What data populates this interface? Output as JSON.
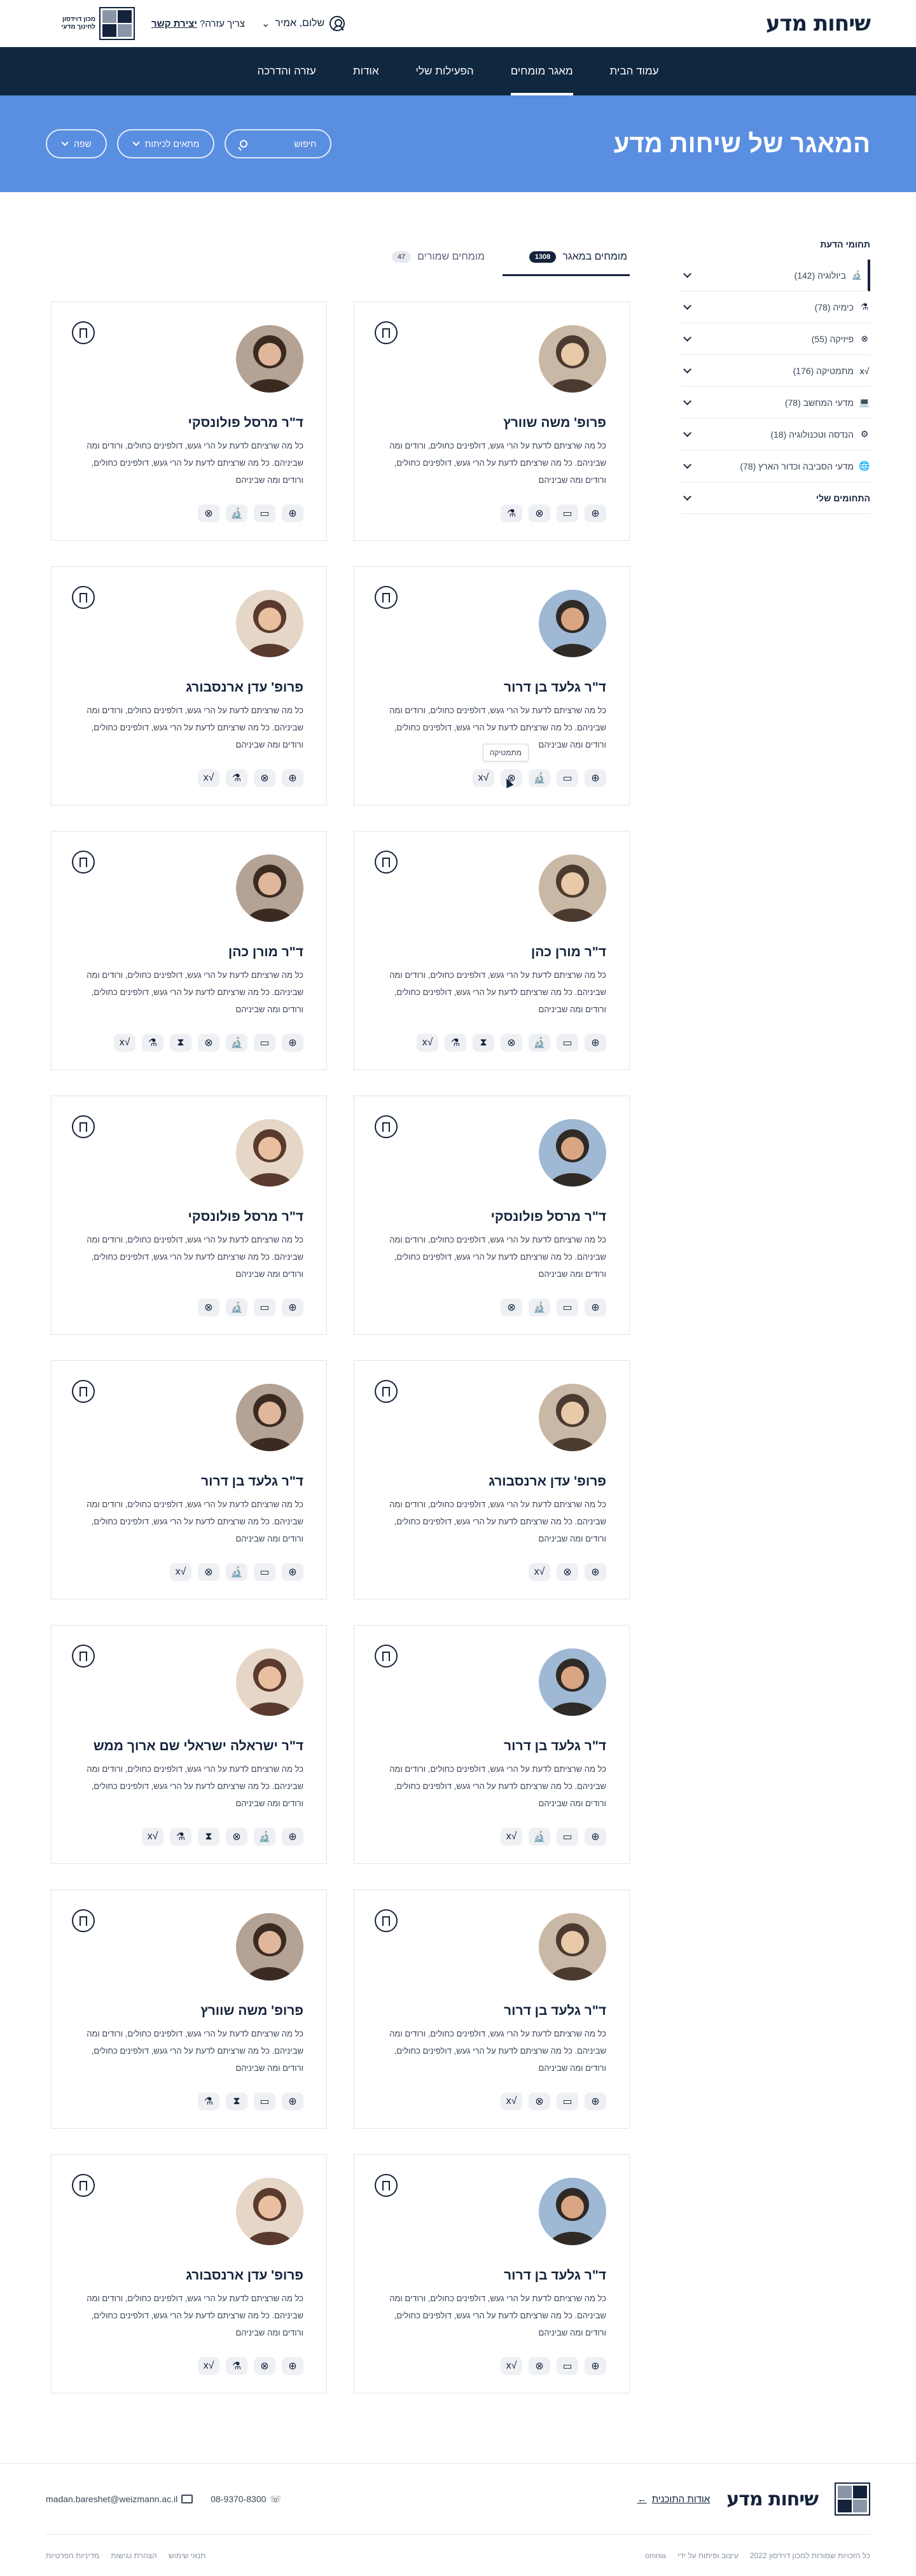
{
  "header": {
    "brand": "שיחות מדע",
    "user_greeting": "שלום, אמיר",
    "help_text": "צריך עזרה?",
    "help_link": "יצירת קשר",
    "logo_text": "מכון דוידסון לחינוך מדעי"
  },
  "nav": {
    "items": [
      {
        "label": "עמוד הבית"
      },
      {
        "label": "מאגר מומחים"
      },
      {
        "label": "הפעילות שלי"
      },
      {
        "label": "אודות"
      },
      {
        "label": "עזרה והדרכה"
      }
    ]
  },
  "hero": {
    "title": "המאגר של שיחות מדע",
    "search_placeholder": "חיפוש",
    "filter_topics": "מתאים לכיתות",
    "filter_year": "שפה"
  },
  "sidebar": {
    "title": "תחומי הדעת",
    "items": [
      {
        "label": "ביולוגיה (142)",
        "icon": "microscope-icon"
      },
      {
        "label": "כימיה (78)",
        "icon": "flask-icon"
      },
      {
        "label": "פיזיקה (55)",
        "icon": "atom-icon"
      },
      {
        "label": "מתמטיקה (176)",
        "icon": "sqrt-icon"
      },
      {
        "label": "מדעי המחשב (78)",
        "icon": "laptop-icon"
      },
      {
        "label": "הנדסה וטכנולוגיה (18)",
        "icon": "gear-icon"
      },
      {
        "label": "מדעי הסביבה וכדור הארץ (78)",
        "icon": "globe-icon"
      }
    ],
    "my_topics": "התחומים שלי"
  },
  "tabs": {
    "experts_label": "מומחים במאגר",
    "experts_count": "1308",
    "saved_label": "מומחים שמורים",
    "saved_count": "47"
  },
  "cards": [
    {
      "name": "פרופ' משה שוורץ",
      "desc": "כל מה שרציתם לדעת על הרי געש, דולפינים כחולים, ורודים ומה שביניהם. כל מה שרציתם לדעת על הרי געש, דולפינים כחולים, ורודים ומה שביניהם"
    },
    {
      "name": "ד\"ר מרסל פולונסקי",
      "desc": "כל מה שרציתם לדעת על הרי געש, דולפינים כחולים, ורודים ומה שביניהם. כל מה שרציתם לדעת על הרי געש, דולפינים כחולים, ורודים ומה שביניהם"
    },
    {
      "name": "ד\"ר גלעד בן דרור",
      "desc": "כל מה שרציתם לדעת על הרי געש, דולפינים כחולים, ורודים ומה שביניהם. כל מה שרציתם לדעת על הרי געש, דולפינים כחולים, ורודים ומה שביניהם",
      "tooltip": "מתמטיקה"
    },
    {
      "name": "פרופ' עדן ארנסבורג",
      "desc": "כל מה שרציתם לדעת על הרי געש, דולפינים כחולים, ורודים ומה שביניהם. כל מה שרציתם לדעת על הרי געש, דולפינים כחולים, ורודים ומה שביניהם"
    },
    {
      "name": "ד\"ר מורן כהן",
      "desc": "כל מה שרציתם לדעת על הרי געש, דולפינים כחולים, ורודים ומה שביניהם. כל מה שרציתם לדעת על הרי געש, דולפינים כחולים, ורודים ומה שביניהם"
    },
    {
      "name": "ד\"ר מורן כהן",
      "desc": "כל מה שרציתם לדעת על הרי געש, דולפינים כחולים, ורודים ומה שביניהם. כל מה שרציתם לדעת על הרי געש, דולפינים כחולים, ורודים ומה שביניהם"
    },
    {
      "name": "ד\"ר מרסל פולונסקי",
      "desc": "כל מה שרציתם לדעת על הרי געש, דולפינים כחולים, ורודים ומה שביניהם. כל מה שרציתם לדעת על הרי געש, דולפינים כחולים, ורודים ומה שביניהם"
    },
    {
      "name": "ד\"ר מרסל פולונסקי",
      "desc": "כל מה שרציתם לדעת על הרי געש, דולפינים כחולים, ורודים ומה שביניהם. כל מה שרציתם לדעת על הרי געש, דולפינים כחולים, ורודים ומה שביניהם"
    },
    {
      "name": "פרופ' עדן ארנסבורג",
      "desc": "כל מה שרציתם לדעת על הרי געש, דולפינים כחולים, ורודים ומה שביניהם. כל מה שרציתם לדעת על הרי געש, דולפינים כחולים, ורודים ומה שביניהם"
    },
    {
      "name": "ד\"ר גלעד בן דרור",
      "desc": "כל מה שרציתם לדעת על הרי געש, דולפינים כחולים, ורודים ומה שביניהם. כל מה שרציתם לדעת על הרי געש, דולפינים כחולים, ורודים ומה שביניהם"
    },
    {
      "name": "ד\"ר גלעד בן דרור",
      "desc": "כל מה שרציתם לדעת על הרי געש, דולפינים כחולים, ורודים ומה שביניהם. כל מה שרציתם לדעת על הרי געש, דולפינים כחולים, ורודים ומה שביניהם"
    },
    {
      "name": "ד\"ר ישראלה ישראלי שם ארוך ממש",
      "desc": "כל מה שרציתם לדעת על הרי געש, דולפינים כחולים, ורודים ומה שביניהם. כל מה שרציתם לדעת על הרי געש, דולפינים כחולים, ורודים ומה שביניהם"
    },
    {
      "name": "ד\"ר גלעד בן דרור",
      "desc": "כל מה שרציתם לדעת על הרי געש, דולפינים כחולים, ורודים ומה שביניהם. כל מה שרציתם לדעת על הרי געש, דולפינים כחולים, ורודים ומה שביניהם"
    },
    {
      "name": "פרופ' משה שוורץ",
      "desc": "כל מה שרציתם לדעת על הרי געש, דולפינים כחולים, ורודים ומה שביניהם. כל מה שרציתם לדעת על הרי געש, דולפינים כחולים, ורודים ומה שביניהם"
    },
    {
      "name": "ד\"ר גלעד בן דרור",
      "desc": "כל מה שרציתם לדעת על הרי געש, דולפינים כחולים, ורודים ומה שביניהם. כל מה שרציתם לדעת על הרי געש, דולפינים כחולים, ורודים ומה שביניהם"
    },
    {
      "name": "פרופ' עדן ארנסבורג",
      "desc": "כל מה שרציתם לדעת על הרי געש, דולפינים כחולים, ורודים ומה שביניהם. כל מה שרציתם לדעת על הרי געש, דולפינים כחולים, ורודים ומה שביניהם"
    }
  ],
  "footer": {
    "brand": "שיחות מדע",
    "about_link": "אודות התוכנית",
    "phone": "08-9370-8300",
    "email": "madan.bareshet@weizmann.ac.il",
    "copyright": "כל הזכויות שמורות למכון דוידסון 2022",
    "credit": "עיצוב ופיתוח על ידי",
    "credit_name": "omnia",
    "links": [
      "תנאי שימוש",
      "הצהרת נגישות",
      "מדיניות הפרטיות"
    ]
  },
  "colors": {
    "navy": "#102740",
    "hero_blue": "#5a8ee0",
    "text": "#14233c"
  }
}
